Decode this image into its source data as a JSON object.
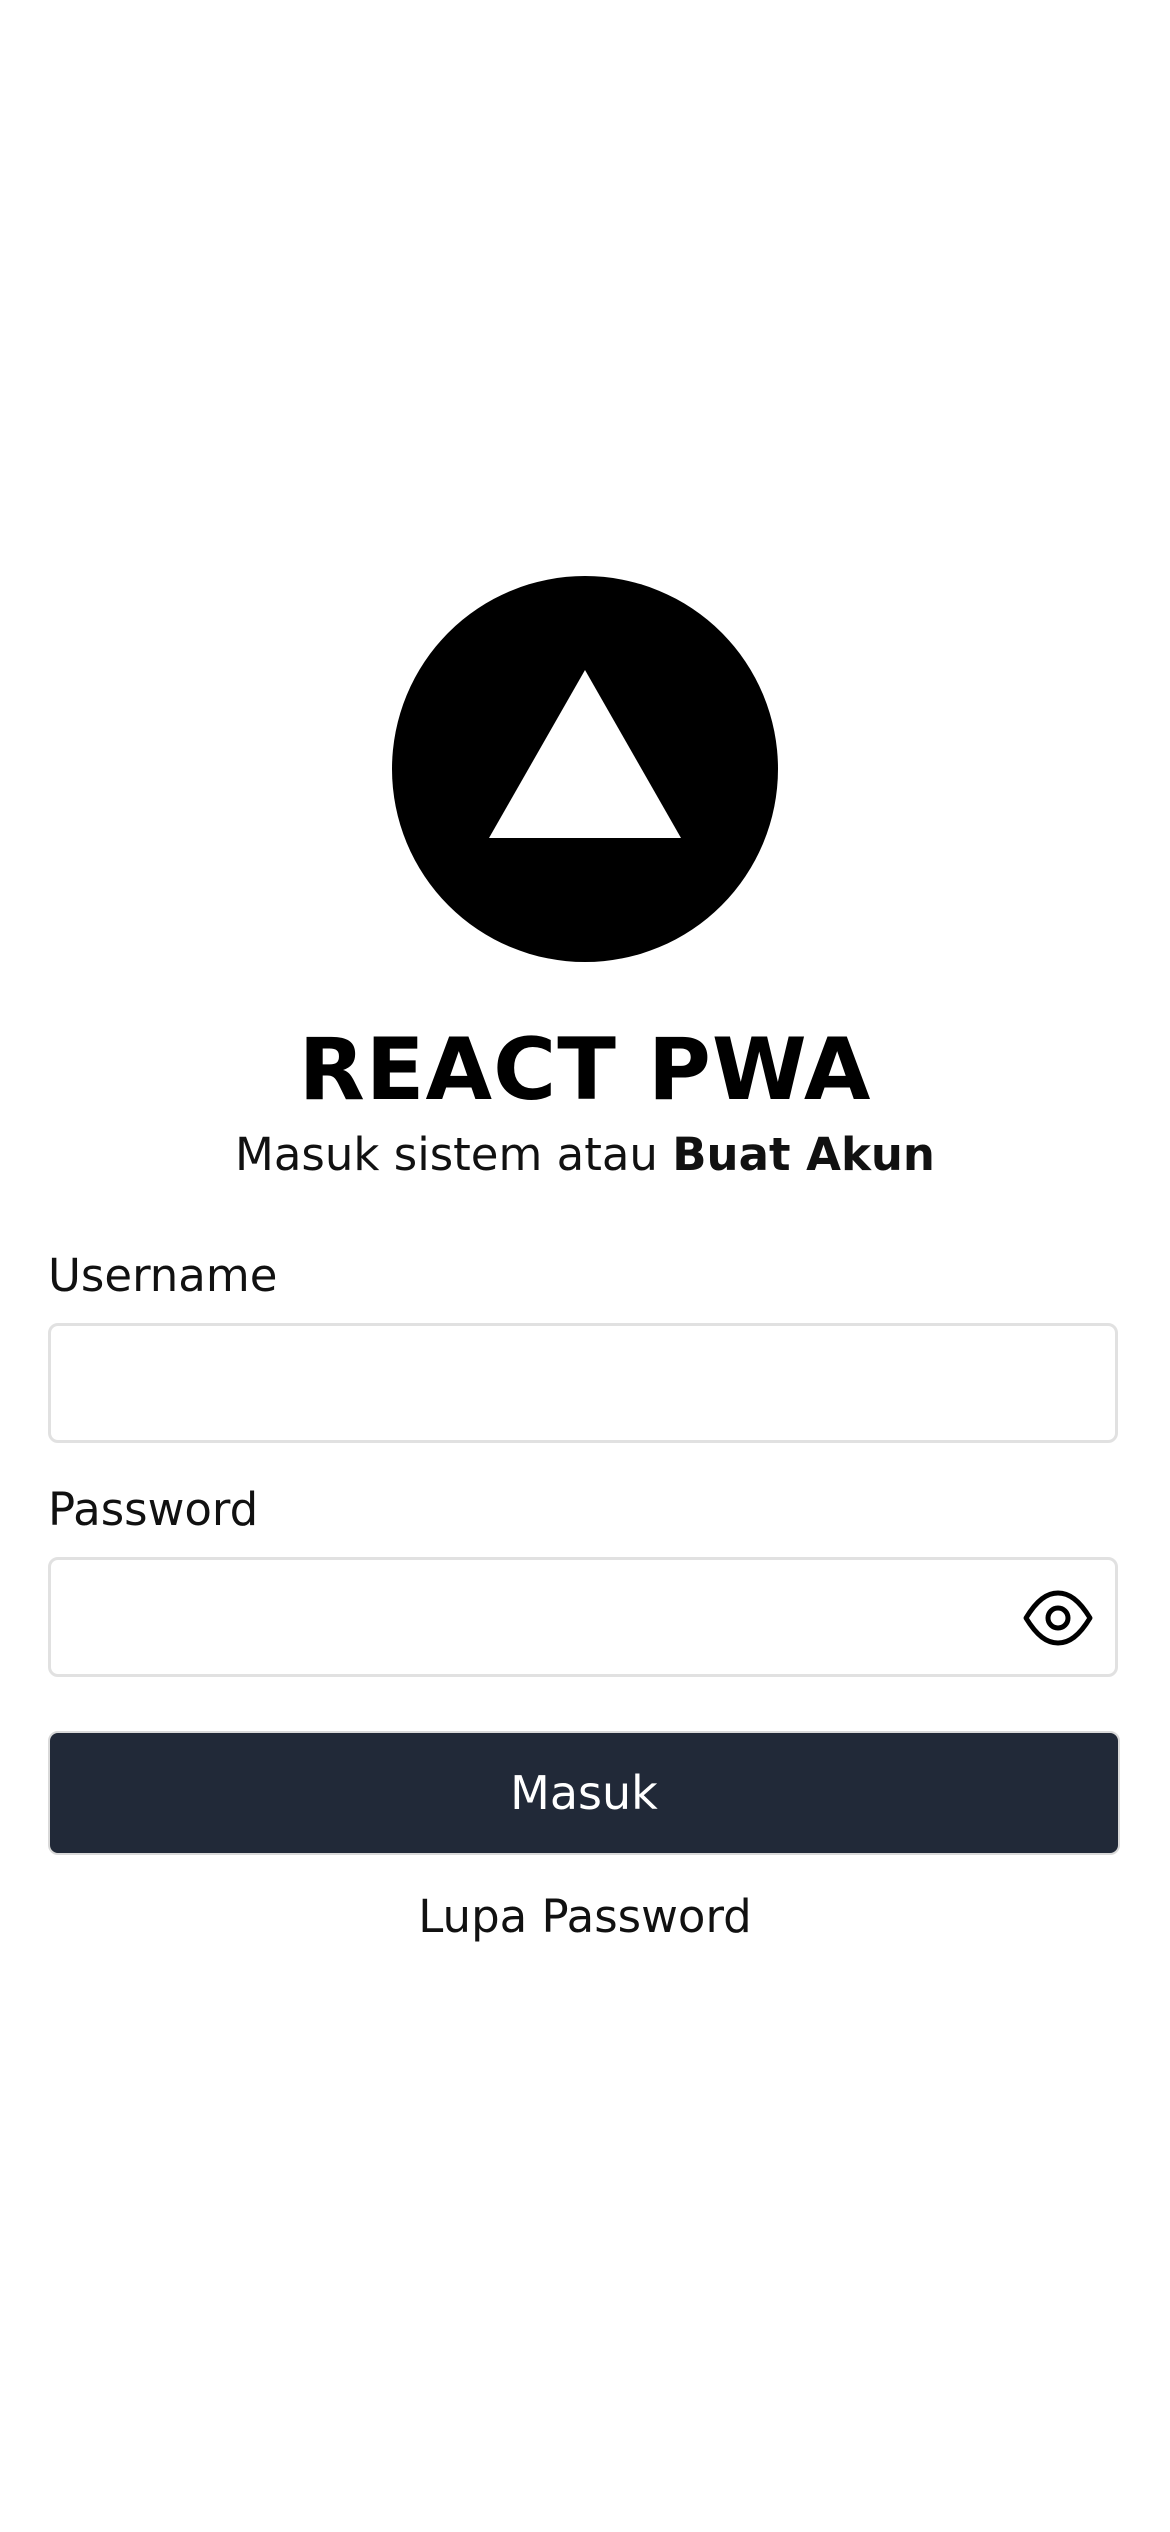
{
  "app": {
    "title": "REACT PWA",
    "subtitle_prefix": "Masuk sistem atau ",
    "create_account_label": "Buat Akun"
  },
  "form": {
    "username_label": "Username",
    "username_value": "",
    "password_label": "Password",
    "password_value": "",
    "submit_label": "Masuk",
    "forgot_password_label": "Lupa Password"
  },
  "icons": {
    "logo": "triangle-logo-icon",
    "password_toggle": "eye-icon"
  },
  "colors": {
    "primary_button": "#212938",
    "logo": "#000000",
    "input_border": "#e1e1e1"
  }
}
